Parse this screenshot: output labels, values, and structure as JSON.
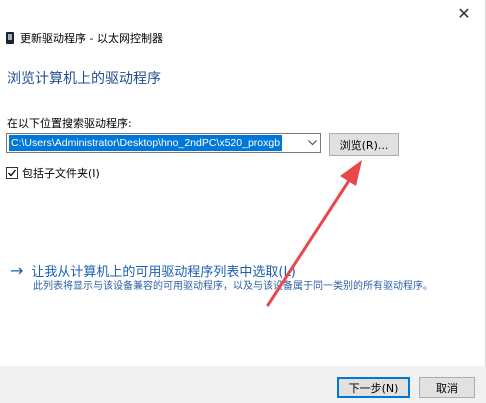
{
  "window": {
    "title": "更新驱动程序 - 以太网控制器",
    "close_glyph": "✕"
  },
  "main": {
    "heading": "浏览计算机上的驱动程序",
    "search_label": "在以下位置搜索驱动程序:",
    "path_value": "C:\\Users\\Administrator\\Desktop\\hno_2ndPC\\x520_proxgb",
    "browse_label": "浏览(R)...",
    "include_subfolders_label": "包括子文件夹(I)",
    "include_subfolders_checked": true,
    "pick_link_label": "让我从计算机上的可用驱动程序列表中选取(L)",
    "pick_link_description": "此列表将显示与该设备兼容的可用驱动程序，以及与该设备属于同一类别的所有驱动程序。"
  },
  "footer": {
    "next_label": "下一步(N)",
    "cancel_label": "取消"
  },
  "colors": {
    "heading": "#1d4e91",
    "link": "#1a5fb4",
    "selection": "#0078d7",
    "annotation_arrow": "#e8474c"
  }
}
